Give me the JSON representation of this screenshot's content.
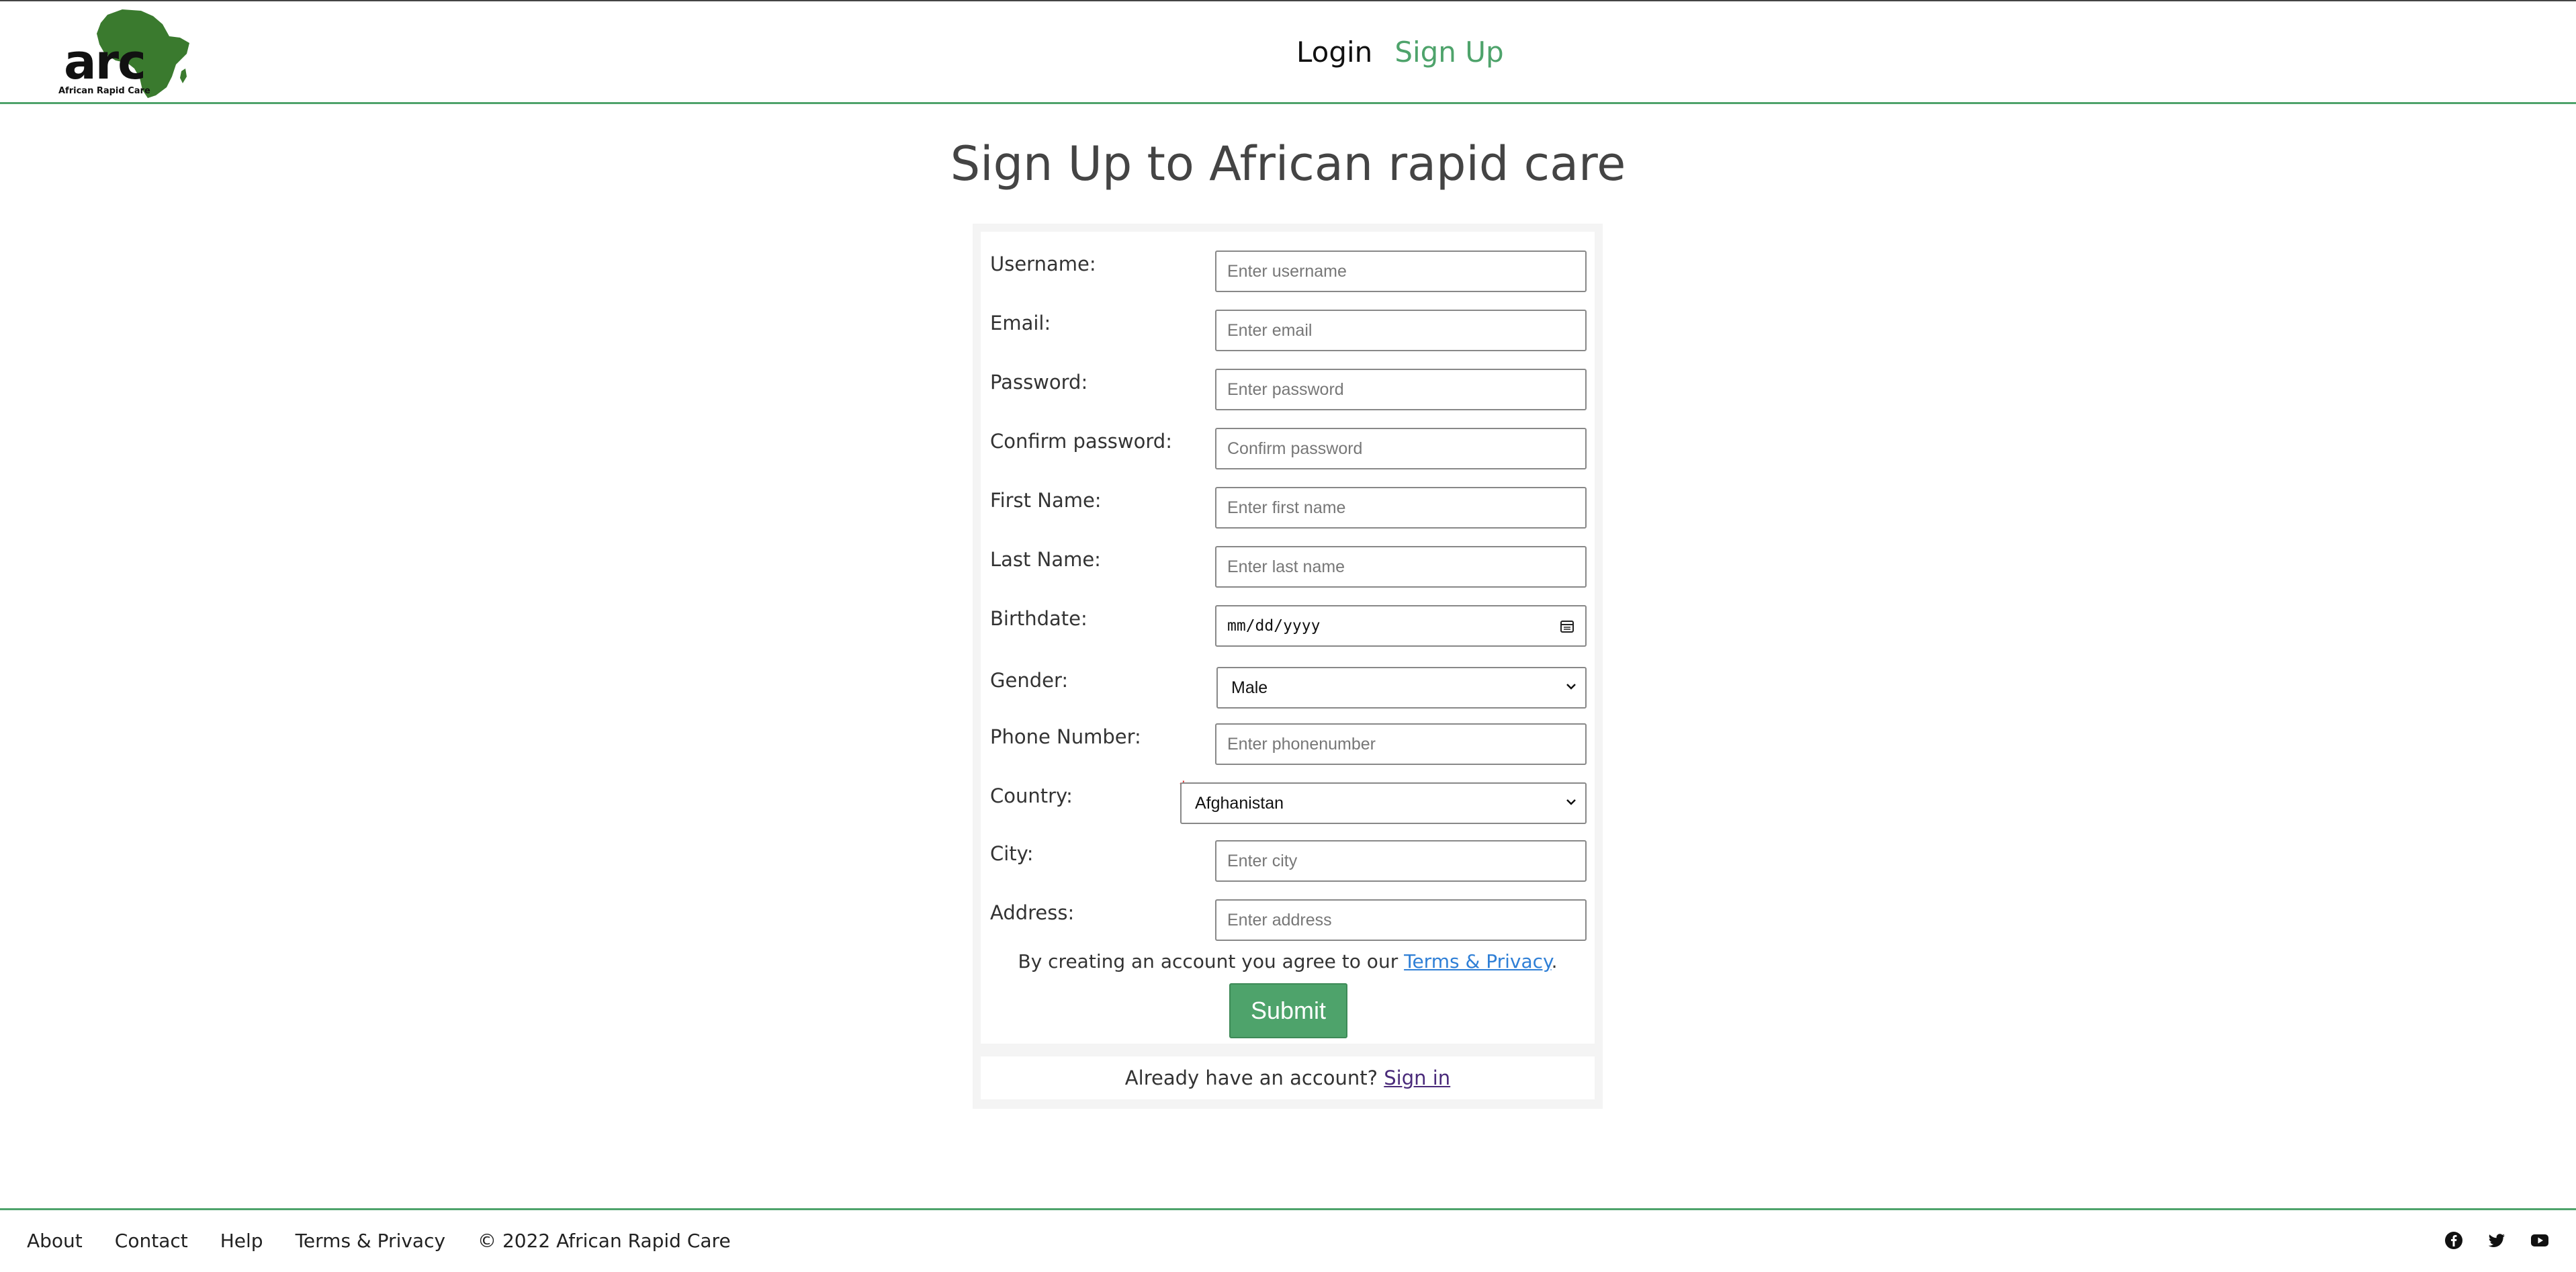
{
  "brand": {
    "logo_text": "arc",
    "logo_subtitle": "African Rapid Care",
    "accent_color": "#4ea36b",
    "logo_color": "#3a7a2e"
  },
  "nav": {
    "login": "Login",
    "signup": "Sign Up"
  },
  "page": {
    "title": "Sign Up to African rapid care"
  },
  "form": {
    "username": {
      "label": "Username:",
      "placeholder": "Enter username"
    },
    "email": {
      "label": "Email:",
      "placeholder": "Enter email"
    },
    "password": {
      "label": "Password:",
      "placeholder": "Enter password"
    },
    "confirm_password": {
      "label": "Confirm password:",
      "placeholder": "Confirm password"
    },
    "first_name": {
      "label": "First Name:",
      "placeholder": "Enter first name"
    },
    "last_name": {
      "label": "Last Name:",
      "placeholder": "Enter last name"
    },
    "birthdate": {
      "label": "Birthdate:",
      "value": "mm/dd/yyyy"
    },
    "gender": {
      "label": "Gender:",
      "selected": "Male"
    },
    "phone": {
      "label": "Phone Number:",
      "placeholder": "Enter phonenumber"
    },
    "country": {
      "label": "Country:",
      "selected": "Afghanistan",
      "required_mark": "*"
    },
    "city": {
      "label": "City:",
      "placeholder": "Enter city"
    },
    "address": {
      "label": "Address:",
      "placeholder": "Enter address"
    },
    "agree_prefix": "By creating an account you agree to our ",
    "agree_link": "Terms & Privacy",
    "agree_suffix": ".",
    "submit": "Submit"
  },
  "signin": {
    "prompt": "Already have an account? ",
    "link": "Sign in"
  },
  "footer": {
    "about": "About",
    "contact": "Contact",
    "help": "Help",
    "terms": "Terms & Privacy",
    "copyright": "© 2022 African Rapid Care",
    "social": [
      "facebook-icon",
      "twitter-icon",
      "youtube-icon"
    ]
  }
}
